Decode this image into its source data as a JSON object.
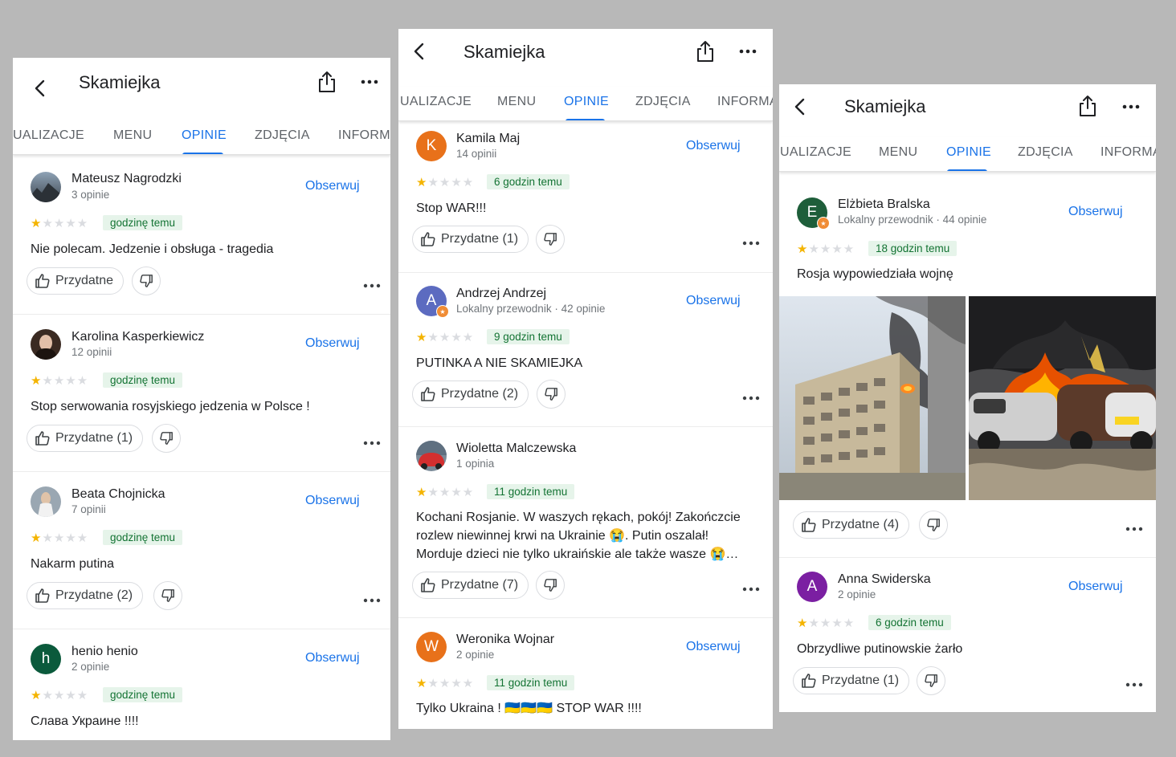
{
  "app": {
    "place_name": "Skamiejka",
    "follow_label": "Obserwuj",
    "helpful_label": "Przydatne"
  },
  "tabs": [
    "UALIZACJE",
    "MENU",
    "OPINIE",
    "ZDJĘCIA",
    "INFORMA"
  ],
  "active_tab": "OPINIE",
  "panel_left": {
    "reviews": [
      {
        "name": "Mateusz Nagrodzki",
        "sub": "3 opinie",
        "rating": 1,
        "time": "godzinę temu",
        "text": "Nie polecam. Jedzenie i obsługa - tragedia",
        "helpful": "Przydatne"
      },
      {
        "name": "Karolina Kasperkiewicz",
        "sub": "12 opinii",
        "rating": 1,
        "time": "godzinę temu",
        "text": "Stop serwowania rosyjskiego jedzenia w Polsce !",
        "helpful": "Przydatne (1)"
      },
      {
        "name": "Beata Chojnicka",
        "sub": "7 opinii",
        "rating": 1,
        "time": "godzinę temu",
        "text": "Nakarm putina",
        "helpful": "Przydatne (2)"
      },
      {
        "name": "henio henio",
        "initial": "h",
        "sub": "2 opinie",
        "rating": 1,
        "time": "godzinę temu",
        "text": "Слава Украине !!!!"
      }
    ]
  },
  "panel_middle": {
    "reviews": [
      {
        "name": "Kamila Maj",
        "initial": "K",
        "sub": "14 opinii",
        "rating": 1,
        "time": "6 godzin temu",
        "text": "Stop WAR!!!",
        "helpful": "Przydatne (1)"
      },
      {
        "name": "Andrzej Andrzej",
        "initial": "A",
        "sub": "Lokalny przewodnik · 42 opinie",
        "rating": 1,
        "time": "9 godzin temu",
        "text": "PUTINKA A NIE SKAMIEJKA",
        "helpful": "Przydatne (2)"
      },
      {
        "name": "Wioletta Malczewska",
        "sub": "1 opinia",
        "rating": 1,
        "time": "11 godzin temu",
        "text_lines": [
          "Kochani Rosjanie. W waszych rękach, pokój! Zakończcie",
          "rozlew niewinnej krwi na Ukrainie 😭. Putin oszalał!",
          "Morduje dzieci nie tylko ukraińskie ale także wasze 😭…"
        ],
        "helpful": "Przydatne (7)"
      },
      {
        "name": "Weronika Wojnar",
        "initial": "W",
        "sub": "2 opinie",
        "rating": 1,
        "time": "11 godzin temu",
        "text": "Tylko Ukraina ! 🇺🇦🇺🇦🇺🇦 STOP WAR !!!!"
      }
    ]
  },
  "panel_right": {
    "reviews": [
      {
        "name": "Elżbieta Bralska",
        "initial": "E",
        "sub": "Lokalny przewodnik · 44 opinie",
        "rating": 1,
        "time": "18 godzin temu",
        "text": "Rosja wypowiedziała wojnę",
        "helpful": "Przydatne (4)",
        "photos": [
          "burning-apartment-building",
          "burning-cars"
        ]
      },
      {
        "name": "Anna Swiderska",
        "initial": "A",
        "sub": "2 opinie",
        "rating": 1,
        "time": "6 godzin temu",
        "text": "Obrzydliwe putinowskie żarło",
        "helpful": "Przydatne (1)"
      }
    ]
  },
  "colors": {
    "accent": "#1a73e8",
    "star": "#f4b400",
    "time_bg": "#e6f4ea",
    "time_fg": "#137333",
    "avatar_k": "#e8711a",
    "avatar_andrzej": "#5c6bc0",
    "avatar_w": "#e8711a",
    "avatar_h": "#0b5a3c",
    "avatar_e": "#1e5e3a",
    "avatar_anna": "#7b1fa2"
  }
}
